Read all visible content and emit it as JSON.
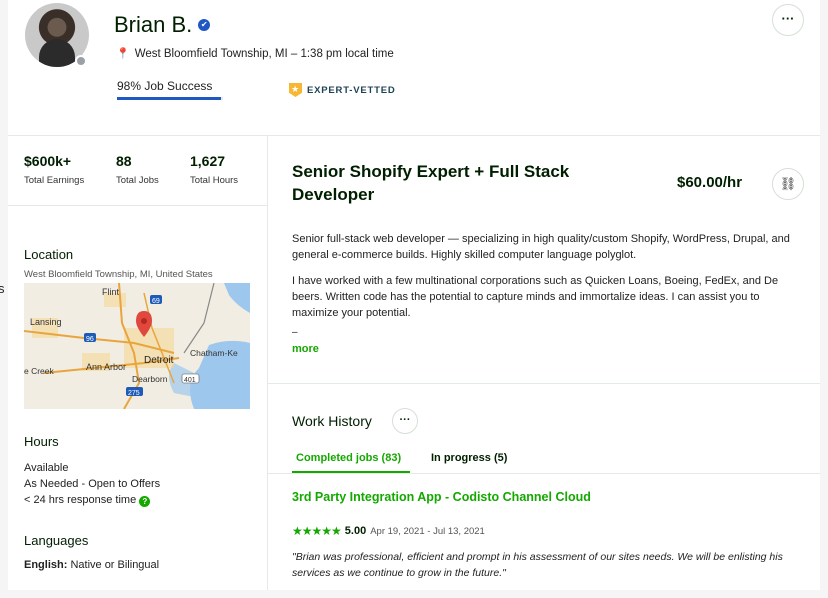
{
  "edge": {
    "fragment": "s"
  },
  "profile": {
    "name": "Brian B.",
    "location": "West Bloomfield Township, MI – 1:38 pm local time",
    "job_success_label": "98% Job Success",
    "job_success_value": 0.98,
    "badge": "EXPERT-VETTED"
  },
  "stats": [
    {
      "value": "$600k+",
      "label": "Total Earnings"
    },
    {
      "value": "88",
      "label": "Total Jobs"
    },
    {
      "value": "1,627",
      "label": "Total Hours"
    }
  ],
  "sidebar": {
    "location_title": "Location",
    "location_detail": "West Bloomfield Township, MI, United States",
    "map_labels": {
      "flint": "Flint",
      "lansing": "Lansing",
      "detroit": "Detroit",
      "chatham": "Chatham-Ke",
      "ann_arbor": "Ann Arbor",
      "dearborn": "Dearborn",
      "creek": "e Creek",
      "hwy69": "69",
      "hwy96": "96",
      "hwy401": "401",
      "hwy275": "275"
    },
    "hours_title": "Hours",
    "hours_lines": [
      "Available",
      "As Needed - Open to Offers",
      "< 24 hrs response time"
    ],
    "languages_title": "Languages",
    "language_name": "English:",
    "language_level": "Native or Bilingual"
  },
  "main": {
    "title": "Senior Shopify Expert + Full Stack Developer",
    "rate": "$60.00/hr",
    "overview_p1": "Senior full-stack web developer — specializing in high quality/custom Shopify, WordPress, Drupal, and general e-commerce builds. Highly skilled computer language polyglot.",
    "overview_p2": "I have worked with a few multinational corporations such as Quicken Loans, Boeing, FedEx, and De beers. Written code has the potential to capture minds and immortalize ideas. I can assist you to maximize your potential.",
    "dash": "–",
    "more_label": "more"
  },
  "work_history": {
    "title": "Work History",
    "tabs": [
      {
        "label": "Completed jobs (83)"
      },
      {
        "label": "In progress (5)"
      }
    ],
    "jobs": [
      {
        "title": "3rd Party Integration App - Codisto Channel Cloud",
        "rating": "5.00",
        "stars": 5,
        "dates": "Apr 19, 2021 - Jul 13, 2021",
        "review": "\"Brian was professional, efficient and prompt in his assessment of our sites needs. We will be enlisting his services as we continue to grow in the future.\""
      }
    ]
  },
  "colors": {
    "accent_green": "#14a800",
    "job_success_blue": "#1f57c3",
    "badge_gold": "#f7b733"
  },
  "icons": {
    "verified": "verified-badge-icon",
    "pin": "location-pin-icon",
    "more": "ellipsis-icon",
    "link": "link-icon",
    "help": "question-icon",
    "star": "star-icon"
  }
}
